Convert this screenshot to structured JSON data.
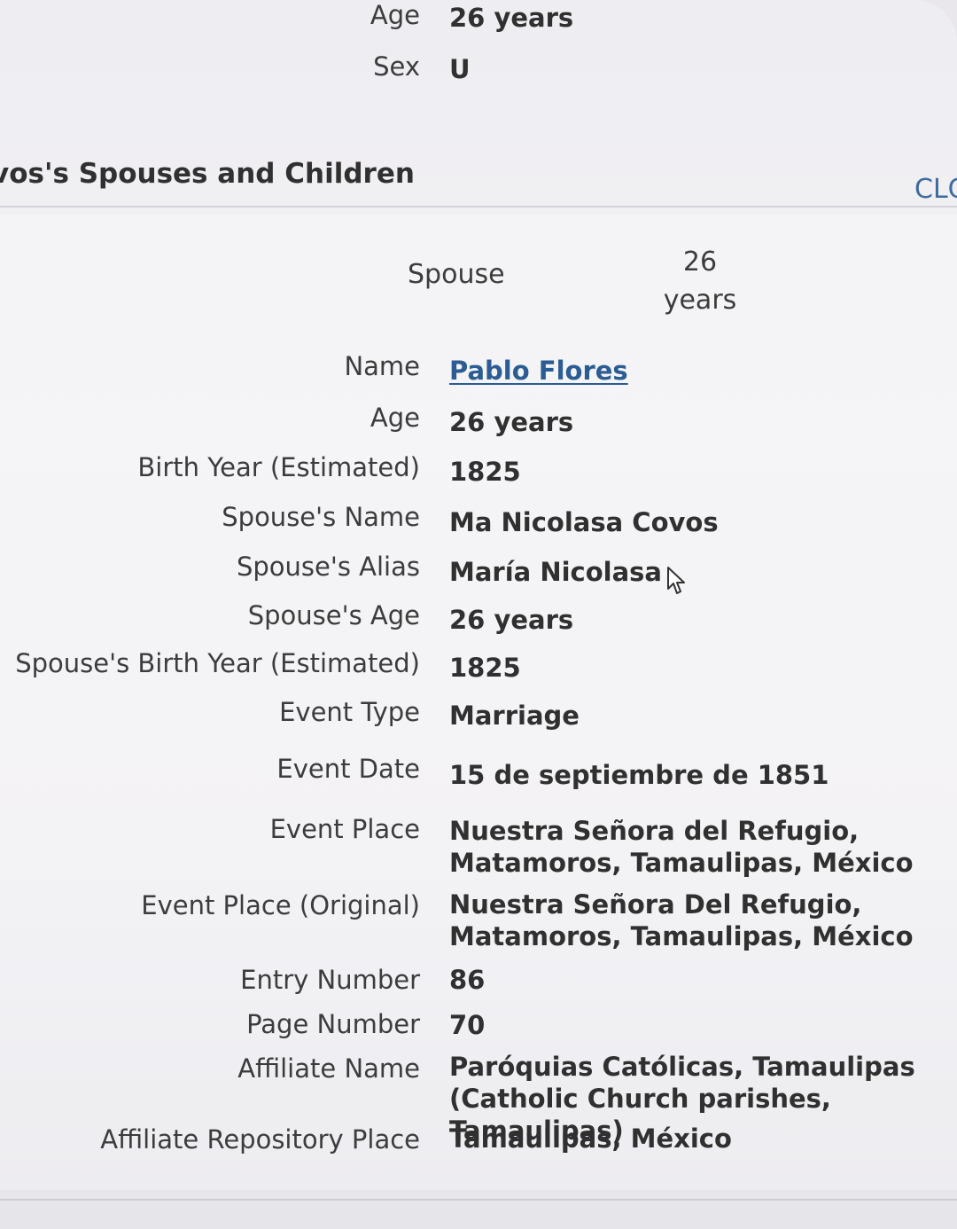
{
  "top": {
    "age_label": "Age",
    "age_value": "26 years",
    "sex_label": "Sex",
    "sex_value": "U"
  },
  "section": {
    "title": "vos's Spouses and Children",
    "close_label": "CLC"
  },
  "spouse_header": {
    "label": "Spouse",
    "age_number": "26",
    "age_unit": "years"
  },
  "details": [
    {
      "label": "Name",
      "value": "Pablo Flores"
    },
    {
      "label": "Age",
      "value": "26 years"
    },
    {
      "label": "Birth Year (Estimated)",
      "value": "1825"
    },
    {
      "label": "Spouse's Name",
      "value": "Ma Nicolasa Covos"
    },
    {
      "label": "Spouse's Alias",
      "value": "María Nicolasa"
    },
    {
      "label": "Spouse's Age",
      "value": "26 years"
    },
    {
      "label": "Spouse's Birth Year (Estimated)",
      "value": "1825"
    },
    {
      "label": "Event Type",
      "value": "Marriage"
    },
    {
      "label": "Event Date",
      "value": "15 de septiembre de 1851"
    },
    {
      "label": "Event Place",
      "value": "Nuestra Señora del Refugio, Matamoros, Tamaulipas, México"
    },
    {
      "label": "Event Place (Original)",
      "value": "Nuestra Señora Del Refugio, Matamoros, Tamaulipas, México"
    },
    {
      "label": "Entry Number",
      "value": "86"
    },
    {
      "label": "Page Number",
      "value": "70"
    },
    {
      "label": "Affiliate Name",
      "value": "Paróquias Católicas, Tamaulipas (Catholic Church parishes, Tamaulipas)"
    },
    {
      "label": "Affiliate Repository Place",
      "value": "Tamaulipas, México"
    }
  ],
  "icons": {
    "cursor": "mouse-pointer-icon"
  },
  "colors": {
    "link": "#2b5c93",
    "close": "#3f6aa0"
  }
}
